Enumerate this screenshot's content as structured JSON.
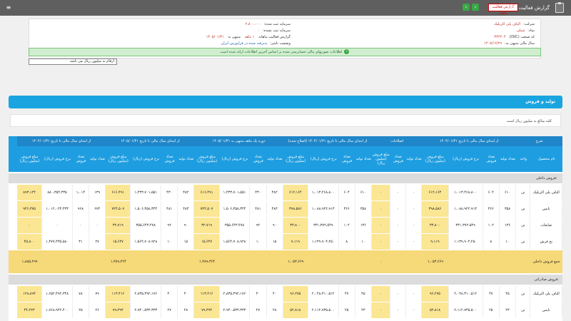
{
  "window": {
    "title": "گزارش فعالیت ماهانه",
    "badge": "گزارش فعالیت ماهانه",
    "nav_prev": "‹",
    "nav_next": "›"
  },
  "header": {
    "company_label": "شرکت:",
    "company_value": "الیاف پلی اکریلیک",
    "symbol_label": "نماد:",
    "symbol_value": "شپلی",
    "isic_label": "کد صنعت (ISIC):",
    "isic_value": "۳۳۶۴۰۴",
    "period_label": "سال مالی منتهی به:",
    "period_value": "۱۴۰۵/۱۲/۲۹",
    "capital_label": "سرمایه ثبت شده:",
    "capital_value": "۲،۸۰۰،۰۰۰",
    "unreg_capital_label": "سرمایه ثبت نشده:",
    "unreg_capital_value": "۰",
    "report_label": "گزارش فعالیت ماهانه",
    "report_month": "۱ ماهه",
    "report_end_label": "منتهی به",
    "report_end_value": "۱۴۰۵/۰۱/۳۱",
    "status_label": "وضعیت ناشر:",
    "status_value": "پذیرفته شده در فرابورس ایران"
  },
  "notice": "اطلاعات صورتهای مالی حسابرسی شده بر اساس آخرین اطلاعات ارائه شده است",
  "unit": "ارقام به میلیون ریال می باشد",
  "section_title": "تولید و فروش",
  "description": "کلیه مبالغ به میلیون ریال است",
  "table": {
    "group_headers": [
      "شرح",
      "از ابتدای سال مالی تا تاریخ ۱۴۰۴/۰۱/۳۱",
      "اصلاحات",
      "از ابتدای سال مالی تا تاریخ ۱۴۰۴/۰۱/۳۱ (اصلاح شده)",
      "دوره یک ماهه منتهی به ۱۴۰۵/۰۱/۳۱",
      "از ابتدای سال مالی تا تاریخ ۱۴۰۵/۰۱/۳۱",
      "از ابتدای سال مالی تا تاریخ ۱۴۰۴/۰۱/۳۱"
    ],
    "sub_headers": [
      "نام محصول",
      "واحد",
      "تعداد تولید",
      "تعداد فروش",
      "نرخ فروش (ریال)",
      "مبلغ فروش (میلیون ریال)",
      "تعداد تولید",
      "تعداد فروش",
      "مبلغ فروش (میلیون ریال)",
      "تعداد تولید",
      "تعداد فروش",
      "نرخ فروش (ریال)",
      "مبلغ فروش (میلیون ریال)",
      "تعداد تولید",
      "تعداد فروش",
      "نرخ فروش (ریال)",
      "مبلغ فروش (میلیون ریال)",
      "تعداد تولید",
      "تعداد فروش",
      "نرخ فروش (ریال)",
      "مبلغ فروش (میلیون ریال)",
      "تعداد تولید",
      "تعداد فروش",
      "نرخ فروش (ریال)",
      "مبلغ فروش (میلیون ریال)"
    ],
    "category_1": "فروش داخلی:",
    "rows": [
      {
        "name": "الیاف پلی اکریلیک",
        "unit": "تن",
        "c": [
          "۶۱۰",
          "۶۰۴",
          "۱،۰۱۳،۴۶۸،۸۰۰",
          "۶۱۲،۱۶۴",
          "۰",
          "۰",
          "۰",
          "۶۱۰",
          "۶۰۴",
          "۱،۰۱۳،۴۶۸،۸۰۰",
          "۶۱۲،۱۶۴",
          "۴۸۲",
          "۴۳۰",
          "۱،۴۳۳،۷۰۱،۵۵۱",
          "۶۱۶،۴۹۱",
          "۴۸۲",
          "۴۳۰",
          "۱،۴۳۳،۷۰۱،۵۵۱",
          "۶۱۶،۴۹۱",
          "۱۳۹",
          "۱،۰۱۴",
          "۸۸۰،۳۵۴،۳۳۵",
          "۸۹۳،۱۲۴"
        ]
      },
      {
        "name": "تاپس",
        "unit": "تن",
        "c": [
          "۳۵۸",
          "۳۶۶",
          "۱،۰۸۸،۹۲۲،۹۱۳",
          "۳۹۸،۵۸۶",
          "۰",
          "۰",
          "۰",
          "۳۵۸",
          "۳۶۶",
          "۱،۰۸۸،۹۲۲،۹۱۳",
          "۳۹۸،۵۸۶",
          "۴۸۳",
          "۴۸۱",
          "۱،۵۰۶،۳۵۸،۳۴۴",
          "۷۲۴،۵۰۷",
          "۴۸۳",
          "۴۸۱",
          "۱،۵۰۶،۳۵۸،۳۴۴",
          "۷۲۴،۵۰۷",
          "۶۷۴",
          "۹۶۸",
          "۱،۰۱۲،۰۲۳،۴۳۳",
          "۹۴۶،۳۷۵"
        ]
      },
      {
        "name": "ضایعات",
        "unit": "تن",
        "c": [
          "۱۳۶",
          "۱۰۲",
          "۳۳۱،۳۷۲،۵۴۹",
          "۳۳،۸۰۰",
          "۰",
          "۰",
          "۰",
          "۱۳۶",
          "۱۰۲",
          "۳۳۱،۳۷۲،۵۴۹",
          "۳۳،۸۰۰",
          "۹۰",
          "۹۲",
          "۳۵۵،۶۴۳،۴۷۸",
          "۳۲،۷۱۹",
          "۹۰",
          "۹۲",
          "۳۵۵،۶۴۳،۴۷۸",
          "۳۲،۷۱۹",
          "۰",
          "۰",
          "۰",
          "۰"
        ]
      },
      {
        "name": "نخ فرش",
        "unit": "تن",
        "c": [
          "۱۰",
          "۸",
          "۱،۱۳۹،۹۰۴،۲۵۰",
          "۹،۱۱۹",
          "۰",
          "۰",
          "۰",
          "۱۰",
          "۸",
          "۱،۱۳۹،۹۰۴،۲۵۰",
          "۹،۱۱۹",
          "۱۵",
          "۱۰",
          "۱،۵۶۴،۷۰۸،۹۲۸",
          "۱۵،۶۴۷",
          "۱۵",
          "۱۰",
          "۱،۵۶۴،۷۰۸،۹۲۸",
          "۱۵،۶۴۷",
          "۲۷",
          "۳۱",
          "۱،۴۷۷،۴۳۵،۵۸۰",
          "۴۵،۸۰۰"
        ]
      }
    ],
    "subtotal": {
      "name": "جمع فروش داخلی",
      "c": [
        "۱،۰۵۳،۶۶۹",
        "۰",
        "۱،۰۵۳،۶۶۹",
        "۱،۳۸۹،۳۶۴",
        "۱،۳۸۹،۳۶۴",
        "۱،۸۸۵،۲۹۹"
      ]
    },
    "category_2": "فروش صادراتی:",
    "rows2": [
      {
        "name": "الیاف پلی اکریلیک",
        "unit": "تن",
        "c": [
          "۴۵",
          "۴۷",
          "۲،۰۴۸،۳۱۰،۵۱۲",
          "۹۶،۲۷۵",
          "۰",
          "۰",
          "۰",
          "۴۵",
          "۴۷",
          "۲،۰۴۸،۳۱۰،۵۱۲",
          "۹۶،۲۷۵",
          "۴۰",
          "۴۰",
          "۲،۸۳۵،۳۹۲،۱۷۶",
          "۱۱۳،۴۱۶",
          "۴۰",
          "۴۰",
          "۲،۸۳۵،۳۹۲،۱۷۶",
          "۱۱۳،۴۱۶",
          "۷۹",
          "۷۸",
          "۱،۶۵۲،۴۹۲،۳۴۸",
          "۱۲۸،۸۹۴"
        ]
      },
      {
        "name": "تاپس",
        "unit": "تن",
        "c": [
          "۲۳",
          "۲۵",
          "۲،۱۱۲،۷۳۵،۵۰۰",
          "۵۲،۸۱۸",
          "۰",
          "۰",
          "۰",
          "۲۳",
          "۲۵",
          "۲،۱۱۲،۷۳۵،۵۰۰",
          "۵۲،۸۱۸",
          "۲۸",
          "۲۷",
          "۲،۹۴۰،۵۳۳،۳۳۳",
          "۷۹،۳۹۴",
          "۲۸",
          "۲۷",
          "۲،۹۴۰،۵۳۳،۳۳۳",
          "۷۹،۳۹۴",
          "۲۶",
          "۲۵",
          "۱،۷۶۸،۹۴۲،۴۰۰",
          "۴۴،۲۲۳"
        ]
      }
    ]
  }
}
